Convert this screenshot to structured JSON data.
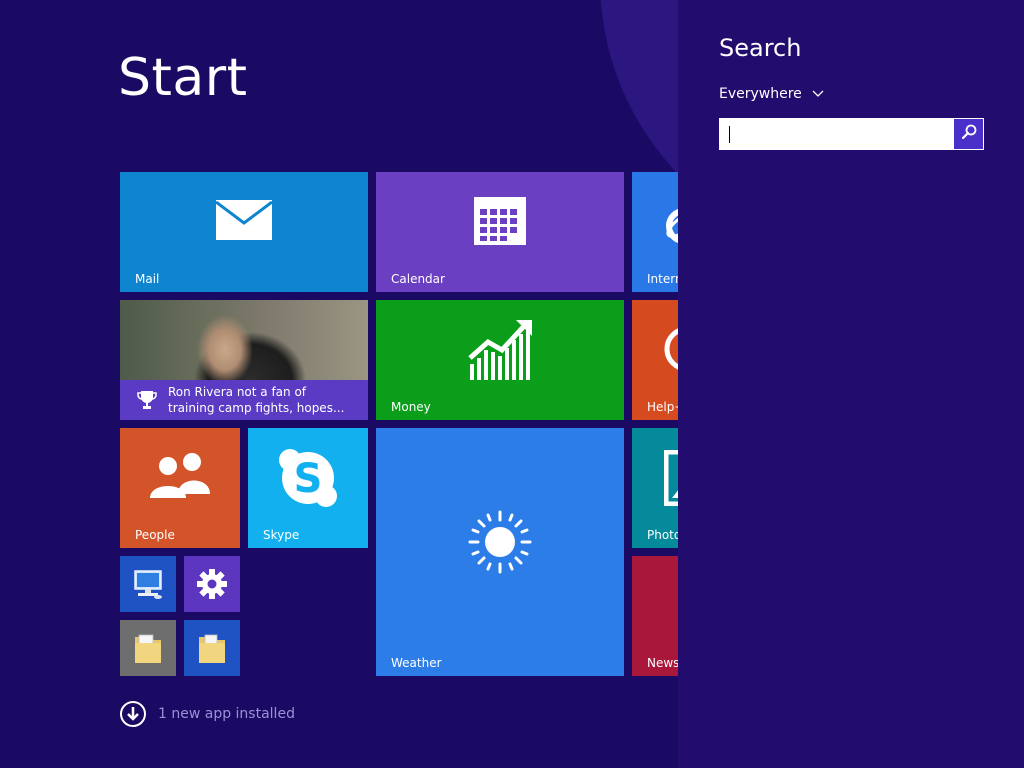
{
  "start": {
    "title": "Start",
    "tiles": {
      "mail": {
        "label": "Mail",
        "color": "#0f85d0"
      },
      "calendar": {
        "label": "Calendar",
        "color": "#6a3fc2"
      },
      "internet": {
        "label": "Intern",
        "color": "#2a78e8"
      },
      "sports": {
        "line1": "Ron Rivera not a fan of",
        "line2": "training camp fights, hopes...",
        "caption_color": "#5b3bc4"
      },
      "money": {
        "label": "Money",
        "color": "#0a9e1a"
      },
      "help": {
        "label": "Help+",
        "color": "#d64a20"
      },
      "people": {
        "label": "People",
        "color": "#d4542a"
      },
      "skype": {
        "label": "Skype",
        "color": "#12b0ef"
      },
      "weather": {
        "label": "Weather",
        "color": "#2c7de8"
      },
      "photos": {
        "label": "Photo",
        "color": "#058a9c"
      },
      "news": {
        "label": "News",
        "color": "#a9173a"
      },
      "this_pc": {
        "color": "#1f52c2"
      },
      "settings": {
        "color": "#5d36c0"
      },
      "file_explorer_1": {
        "color": "#6e6e6e"
      },
      "file_explorer_2": {
        "color": "#1f52c2"
      }
    },
    "notification": "1 new app installed"
  },
  "search": {
    "title": "Search",
    "scope": "Everywhere",
    "input_value": "",
    "placeholder": ""
  }
}
